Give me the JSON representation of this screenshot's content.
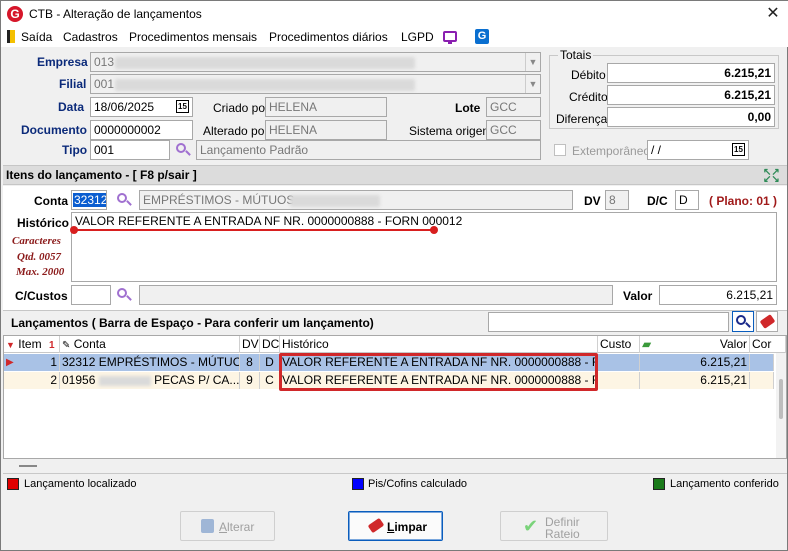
{
  "window": {
    "title": "CTB - Alteração de lançamentos",
    "close_glyph": "✕"
  },
  "menu": {
    "items": [
      "Saída",
      "Cadastros",
      "Procedimentos mensais",
      "Procedimentos diários",
      "LGPD"
    ]
  },
  "header": {
    "empresa_label": "Empresa",
    "empresa_code": "013",
    "filial_label": "Filial",
    "filial_code": "001",
    "data_label": "Data",
    "data_value": "18/06/2025",
    "criado_por_label": "Criado por",
    "criado_por_value": "HELENA",
    "lote_label": "Lote",
    "lote_value": "GCC",
    "documento_label": "Documento",
    "documento_value": "0000000002",
    "alterado_por_label": "Alterado por",
    "alterado_por_value": "HELENA",
    "sistema_origem_label": "Sistema origem",
    "sistema_origem_value": "GCC",
    "tipo_label": "Tipo",
    "tipo_code": "001",
    "tipo_desc": "Lançamento Padrão",
    "extemporaneo_label": "Extemporâneo",
    "extemporaneo_date": " /  /",
    "calendar_glyph": "15"
  },
  "totais": {
    "title": "Totais",
    "debito_label": "Débito",
    "debito_value": "6.215,21",
    "credito_label": "Crédito",
    "credito_value": "6.215,21",
    "diferenca_label": "Diferença",
    "diferenca_value": "0,00"
  },
  "item": {
    "section_title": "Itens do lançamento - [ F8 p/sair ]",
    "conta_label": "Conta",
    "conta_code": "32312",
    "conta_desc": "EMPRÉSTIMOS - MÚTUOS -",
    "dv_label": "DV",
    "dv_value": "8",
    "dc_label": "D/C",
    "dc_value": "D",
    "plano_text": "( Plano: 01 )",
    "historico_label": "Histórico",
    "historico_value": "VALOR REFERENTE A ENTRADA NF NR. 0000000888 - FORN 000012",
    "caracteres_label": "Caracteres",
    "qtd_label": "Qtd. 0057",
    "max_label": "Max. 2000",
    "ccustos_label": "C/Custos",
    "valor_label": "Valor",
    "valor_value": "6.215,21"
  },
  "lancamentos": {
    "title": "Lançamentos ( Barra de Espaço - Para conferir um lançamento)",
    "search_value": "",
    "columns": [
      "Item",
      "Conta",
      "DV",
      "DC",
      "Histórico",
      "Custo",
      "Valor",
      "Cor"
    ],
    "sort_indicator": "1",
    "rows": [
      {
        "item": "1",
        "conta": "32312 EMPRÉSTIMOS - MÚTUO...",
        "dv": "8",
        "dc": "D",
        "historico": "VALOR REFERENTE A ENTRADA NF NR. 0000000888 - FOR...",
        "custo": "",
        "valor": "6.215,21"
      },
      {
        "item": "2",
        "conta_code": "01956",
        "conta_tail": "PECAS P/ CA...",
        "dv": "9",
        "dc": "C",
        "historico": "VALOR REFERENTE A ENTRADA NF NR. 0000000888 - FOR...",
        "custo": "",
        "valor": "6.215,21"
      }
    ]
  },
  "legend": {
    "localizado": "Lançamento localizado",
    "localizado_color": "#e00000",
    "piscofins": "Pis/Cofins calculado",
    "piscofins_color": "#0000ff",
    "conferido": "Lançamento conferido",
    "conferido_color": "#1a7a1a"
  },
  "buttons": {
    "alterar": "Alterar",
    "limpar": "Limpar",
    "definir_rateio_1": "Definir",
    "definir_rateio_2": "Rateio"
  },
  "colors": {
    "accent_red": "#d0282a",
    "selected_row": "#a9c2e6",
    "label_blue": "#0b2a7a"
  }
}
